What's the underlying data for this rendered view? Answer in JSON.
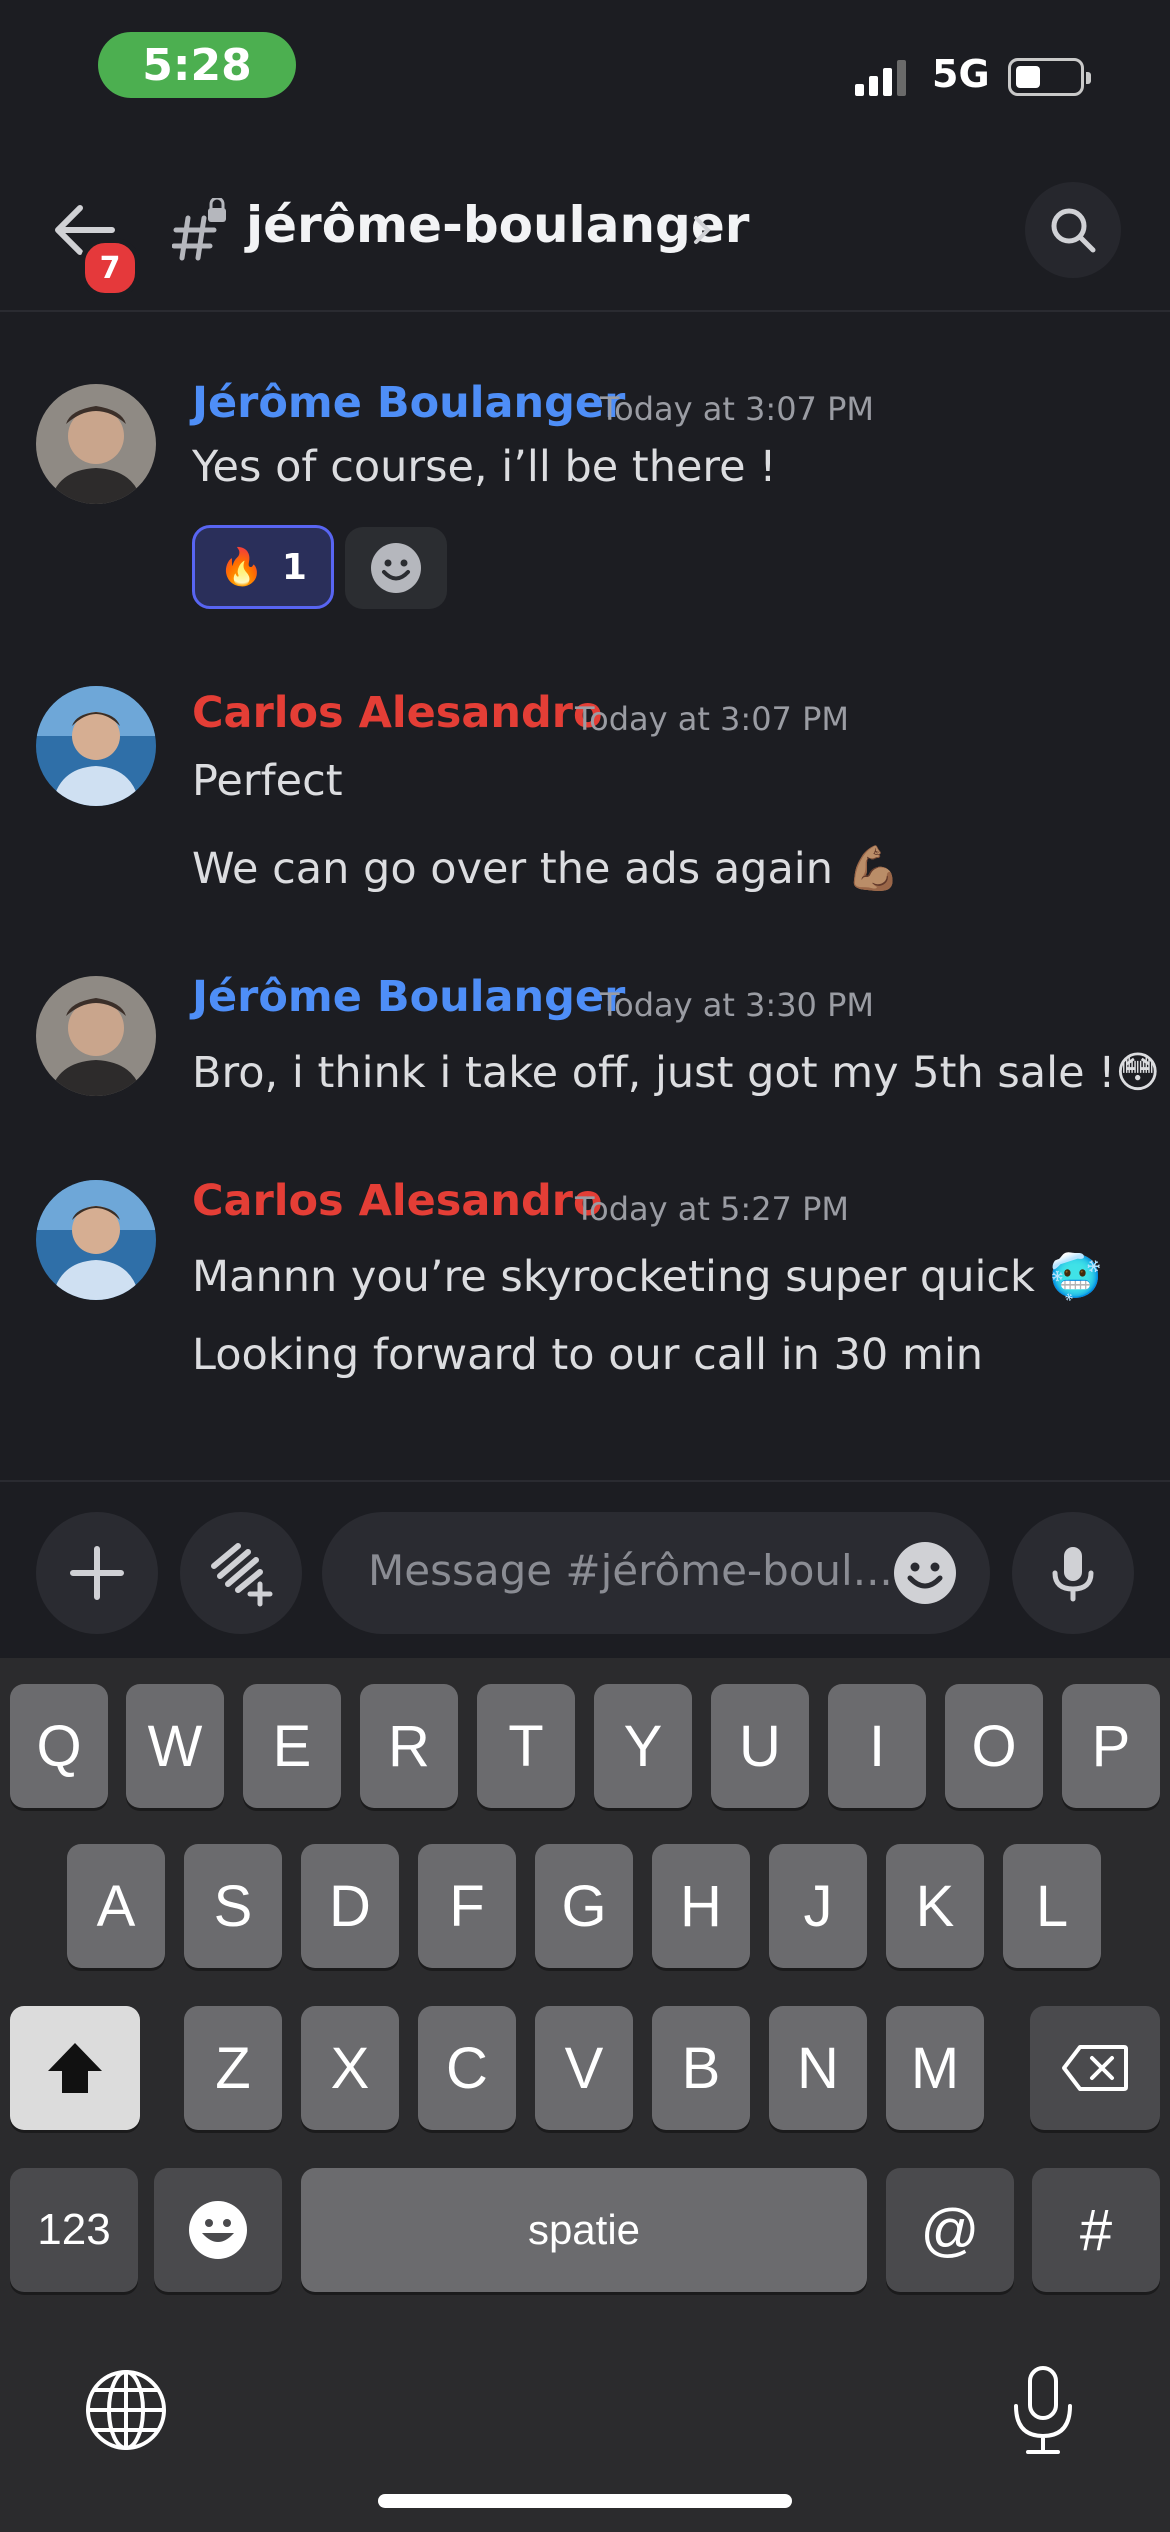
{
  "status_bar": {
    "time": "5:28",
    "network": "5G",
    "signal_bars": 3,
    "battery_level": 0.3
  },
  "header": {
    "back_badge": "7",
    "channel_name": "jérôme-boulanger",
    "chevron": "›"
  },
  "messages": [
    {
      "author": "Jérôme Boulanger",
      "color": "#4e8ef7",
      "timestamp": "Today at 3:07 PM",
      "lines": [
        "Yes of course, i’ll be there !"
      ],
      "reaction": {
        "emoji": "🔥",
        "count": "1"
      }
    },
    {
      "author": "Carlos Alesandro",
      "color": "#e43e36",
      "timestamp": "Today at 3:07 PM",
      "lines": [
        "Perfect",
        "We can go over the ads again 💪🏽"
      ]
    },
    {
      "author": "Jérôme Boulanger",
      "color": "#4e8ef7",
      "timestamp": "Today at 3:30 PM",
      "lines": [
        "Bro, i think i take off, just got my 5th sale !😳"
      ]
    },
    {
      "author": "Carlos Alesandro",
      "color": "#e43e36",
      "timestamp": "Today at 5:27 PM",
      "lines": [
        "Mannn you’re skyrocketing super quick 🥶",
        "Looking forward to our call in 30 min"
      ]
    }
  ],
  "composer": {
    "placeholder": "Message #jérôme-boul..."
  },
  "keyboard": {
    "row1": [
      "Q",
      "W",
      "E",
      "R",
      "T",
      "Y",
      "U",
      "I",
      "O",
      "P"
    ],
    "row2": [
      "A",
      "S",
      "D",
      "F",
      "G",
      "H",
      "J",
      "K",
      "L"
    ],
    "row3": [
      "Z",
      "X",
      "C",
      "V",
      "B",
      "N",
      "M"
    ],
    "numbers": "123",
    "space": "spatie",
    "at": "@",
    "hash": "#"
  }
}
